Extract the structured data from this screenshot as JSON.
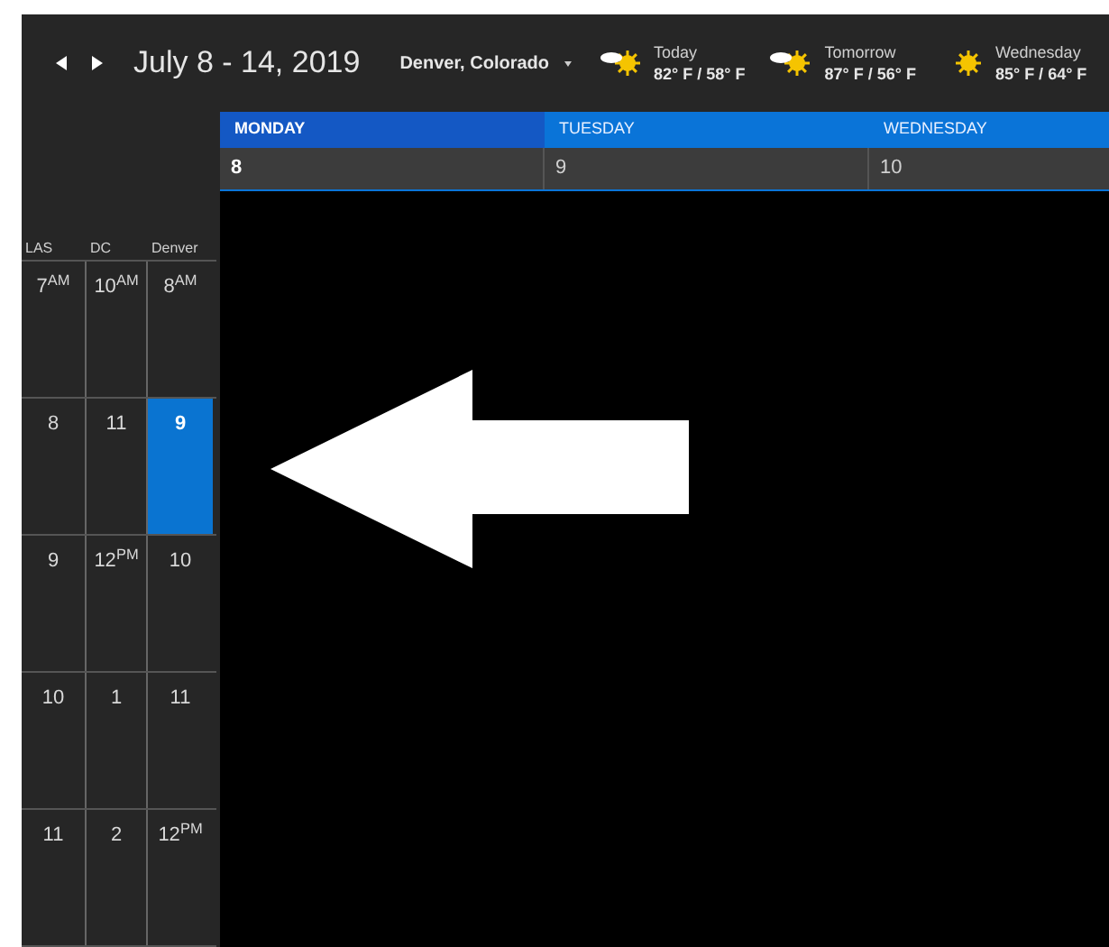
{
  "header": {
    "title": "July 8 - 14, 2019",
    "location": "Denver, Colorado",
    "forecast": [
      {
        "day": "Today",
        "temps": "82° F / 58° F",
        "kind": "partly-cloudy"
      },
      {
        "day": "Tomorrow",
        "temps": "87° F / 56° F",
        "kind": "partly-cloudy"
      },
      {
        "day": "Wednesday",
        "temps": "85° F / 64° F",
        "kind": "sunny"
      }
    ]
  },
  "days": [
    {
      "name": "MONDAY",
      "date": "8",
      "selected": true
    },
    {
      "name": "TUESDAY",
      "date": "9",
      "selected": false
    },
    {
      "name": "WEDNESDAY",
      "date": "10",
      "selected": false
    }
  ],
  "time_zones": [
    "LAS",
    "DC",
    "Denver"
  ],
  "hours": [
    {
      "times": [
        "7$^{AM}$",
        "10$^{AM}$",
        "8$^{AM}$"
      ],
      "current": false
    },
    {
      "times": [
        "8",
        "11",
        "9"
      ],
      "current": true
    },
    {
      "times": [
        "9",
        "12$^{PM}$",
        "10"
      ],
      "current": false
    },
    {
      "times": [
        "10",
        "1",
        "11"
      ],
      "current": false
    },
    {
      "times": [
        "11",
        "2",
        "12$^{PM}$"
      ],
      "current": false
    }
  ]
}
